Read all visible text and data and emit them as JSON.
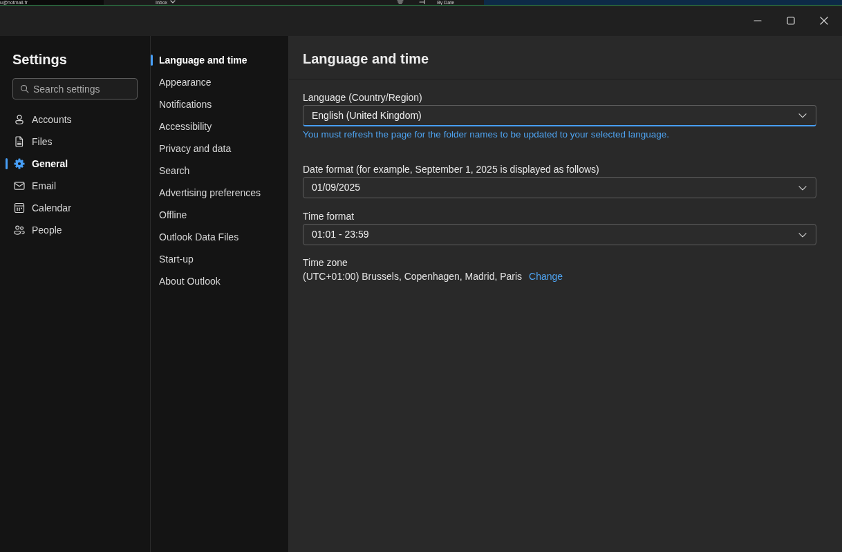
{
  "background_window": {
    "account": "u@hotmail.fr",
    "folder": "Inbox",
    "sort": "By Date"
  },
  "sidebar": {
    "title": "Settings",
    "search": {
      "placeholder": "Search settings"
    },
    "items": [
      {
        "label": "Accounts",
        "selected": false
      },
      {
        "label": "Files",
        "selected": false
      },
      {
        "label": "General",
        "selected": true
      },
      {
        "label": "Email",
        "selected": false
      },
      {
        "label": "Calendar",
        "selected": false
      },
      {
        "label": "People",
        "selected": false
      }
    ]
  },
  "subnav": {
    "items": [
      {
        "label": "Language and time",
        "selected": true
      },
      {
        "label": "Appearance",
        "selected": false
      },
      {
        "label": "Notifications",
        "selected": false
      },
      {
        "label": "Accessibility",
        "selected": false
      },
      {
        "label": "Privacy and data",
        "selected": false
      },
      {
        "label": "Search",
        "selected": false
      },
      {
        "label": "Advertising preferences",
        "selected": false
      },
      {
        "label": "Offline",
        "selected": false
      },
      {
        "label": "Outlook Data Files",
        "selected": false
      },
      {
        "label": "Start-up",
        "selected": false
      },
      {
        "label": "About Outlook",
        "selected": false
      }
    ]
  },
  "content": {
    "title": "Language and time",
    "fields": [
      {
        "label": "Language (Country/Region)",
        "value": "English (United Kingdom)",
        "focused": true,
        "hint": "You must refresh the page for the folder names to be updated to your selected language."
      },
      {
        "label": "Date format (for example, September 1, 2025 is displayed as follows)",
        "value": "01/09/2025",
        "focused": false
      },
      {
        "label": "Time format",
        "value": "01:01 - 23:59",
        "focused": false
      }
    ],
    "time_zone": {
      "label": "Time zone",
      "value": "(UTC+01:00) Brussels, Copenhagen, Madrid, Paris",
      "link": "Change"
    }
  }
}
